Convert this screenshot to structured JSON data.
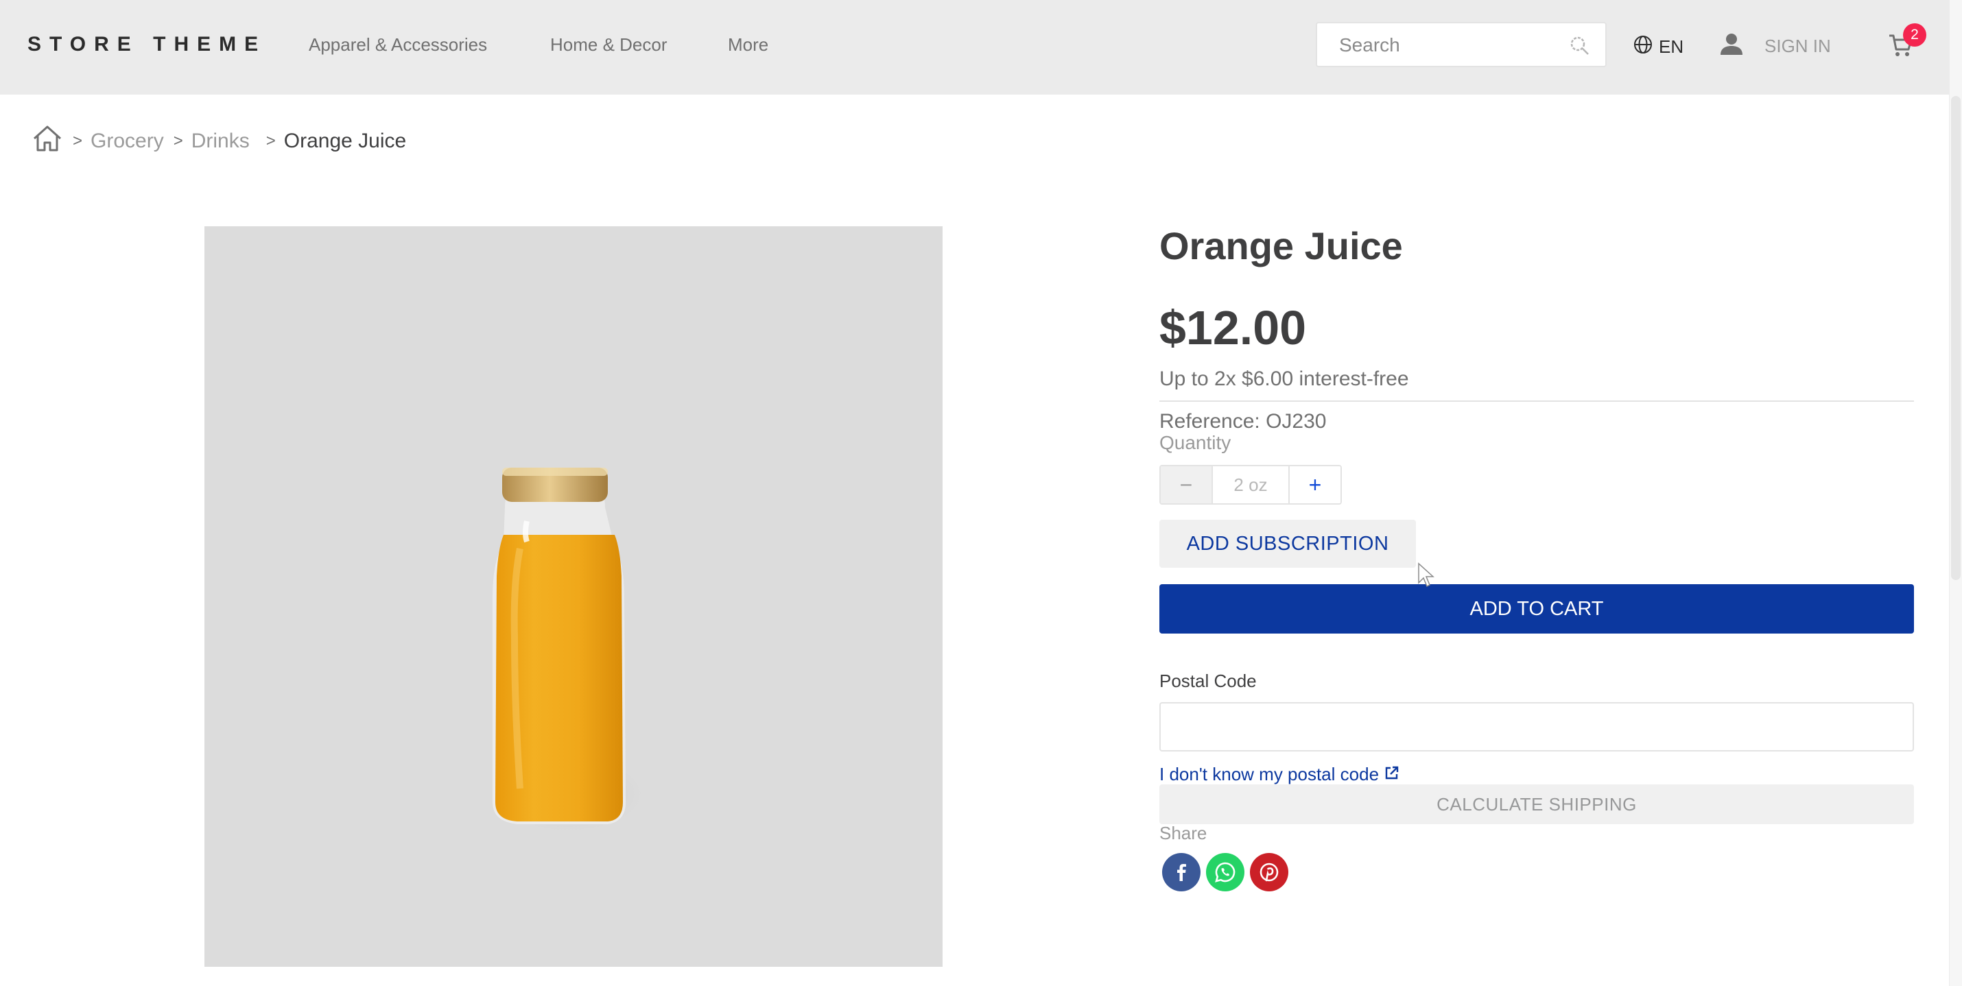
{
  "header": {
    "logo": "STORE THEME",
    "nav": [
      "Apparel & Accessories",
      "Home & Decor",
      "More"
    ],
    "search_placeholder": "Search",
    "language": "EN",
    "sign_in": "SIGN IN",
    "cart_count": "2"
  },
  "breadcrumb": {
    "items": [
      "Grocery",
      "Drinks"
    ],
    "current": "Orange Juice",
    "separator": ">"
  },
  "product": {
    "title": "Orange Juice",
    "price": "$12.00",
    "installments": "Up to 2x $6.00 interest-free",
    "reference": "Reference: OJ230",
    "quantity_label": "Quantity",
    "quantity_value": "2 oz",
    "minus_label": "−",
    "plus_label": "+",
    "add_subscription": "ADD SUBSCRIPTION",
    "add_to_cart": "ADD TO CART"
  },
  "shipping": {
    "postal_label": "Postal Code",
    "postal_value": "",
    "postal_link": "I don't know my postal code",
    "calculate": "CALCULATE SHIPPING"
  },
  "share": {
    "label": "Share",
    "networks": [
      {
        "icon": "facebook-icon",
        "color": "#3b5998"
      },
      {
        "icon": "whatsapp-icon",
        "color": "#25d366"
      },
      {
        "icon": "pinterest-icon",
        "color": "#cb2027"
      }
    ]
  },
  "colors": {
    "primary": "#0c389f",
    "header_bg": "#ebebeb",
    "badge": "#f4244f",
    "text": "#3f3f40",
    "juice": "#f0a81a"
  }
}
